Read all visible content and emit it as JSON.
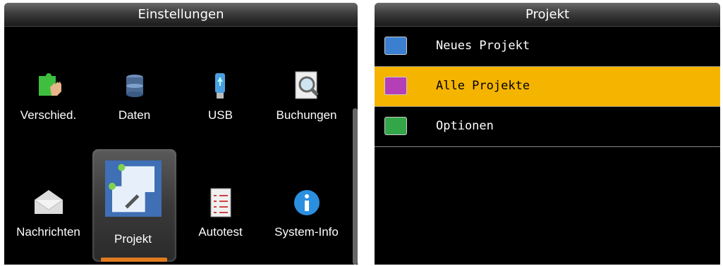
{
  "left": {
    "title": "Einstellungen",
    "items": [
      {
        "label": "Verschied.",
        "icon": "puzzle-hand-icon"
      },
      {
        "label": "Daten",
        "icon": "database-icon"
      },
      {
        "label": "USB",
        "icon": "usb-stick-icon"
      },
      {
        "label": "Buchungen",
        "icon": "magnifier-icon"
      },
      {
        "label": "Nachrichten",
        "icon": "envelope-icon"
      },
      {
        "label": "Projekt",
        "icon": "project-icon",
        "selected": true
      },
      {
        "label": "Autotest",
        "icon": "checklist-icon"
      },
      {
        "label": "System-Info",
        "icon": "info-icon"
      }
    ]
  },
  "right": {
    "title": "Projekt",
    "items": [
      {
        "label": "Neues Projekt",
        "icon": "new-project-icon",
        "color": "#3a7fd0"
      },
      {
        "label": "Alle Projekte",
        "icon": "all-projects-icon",
        "color": "#b43fb6",
        "active": true
      },
      {
        "label": "Optionen",
        "icon": "options-icon",
        "color": "#34a64a"
      }
    ]
  },
  "colors": {
    "highlight": "#f5b400",
    "selection_bar": "#e07a1f"
  }
}
